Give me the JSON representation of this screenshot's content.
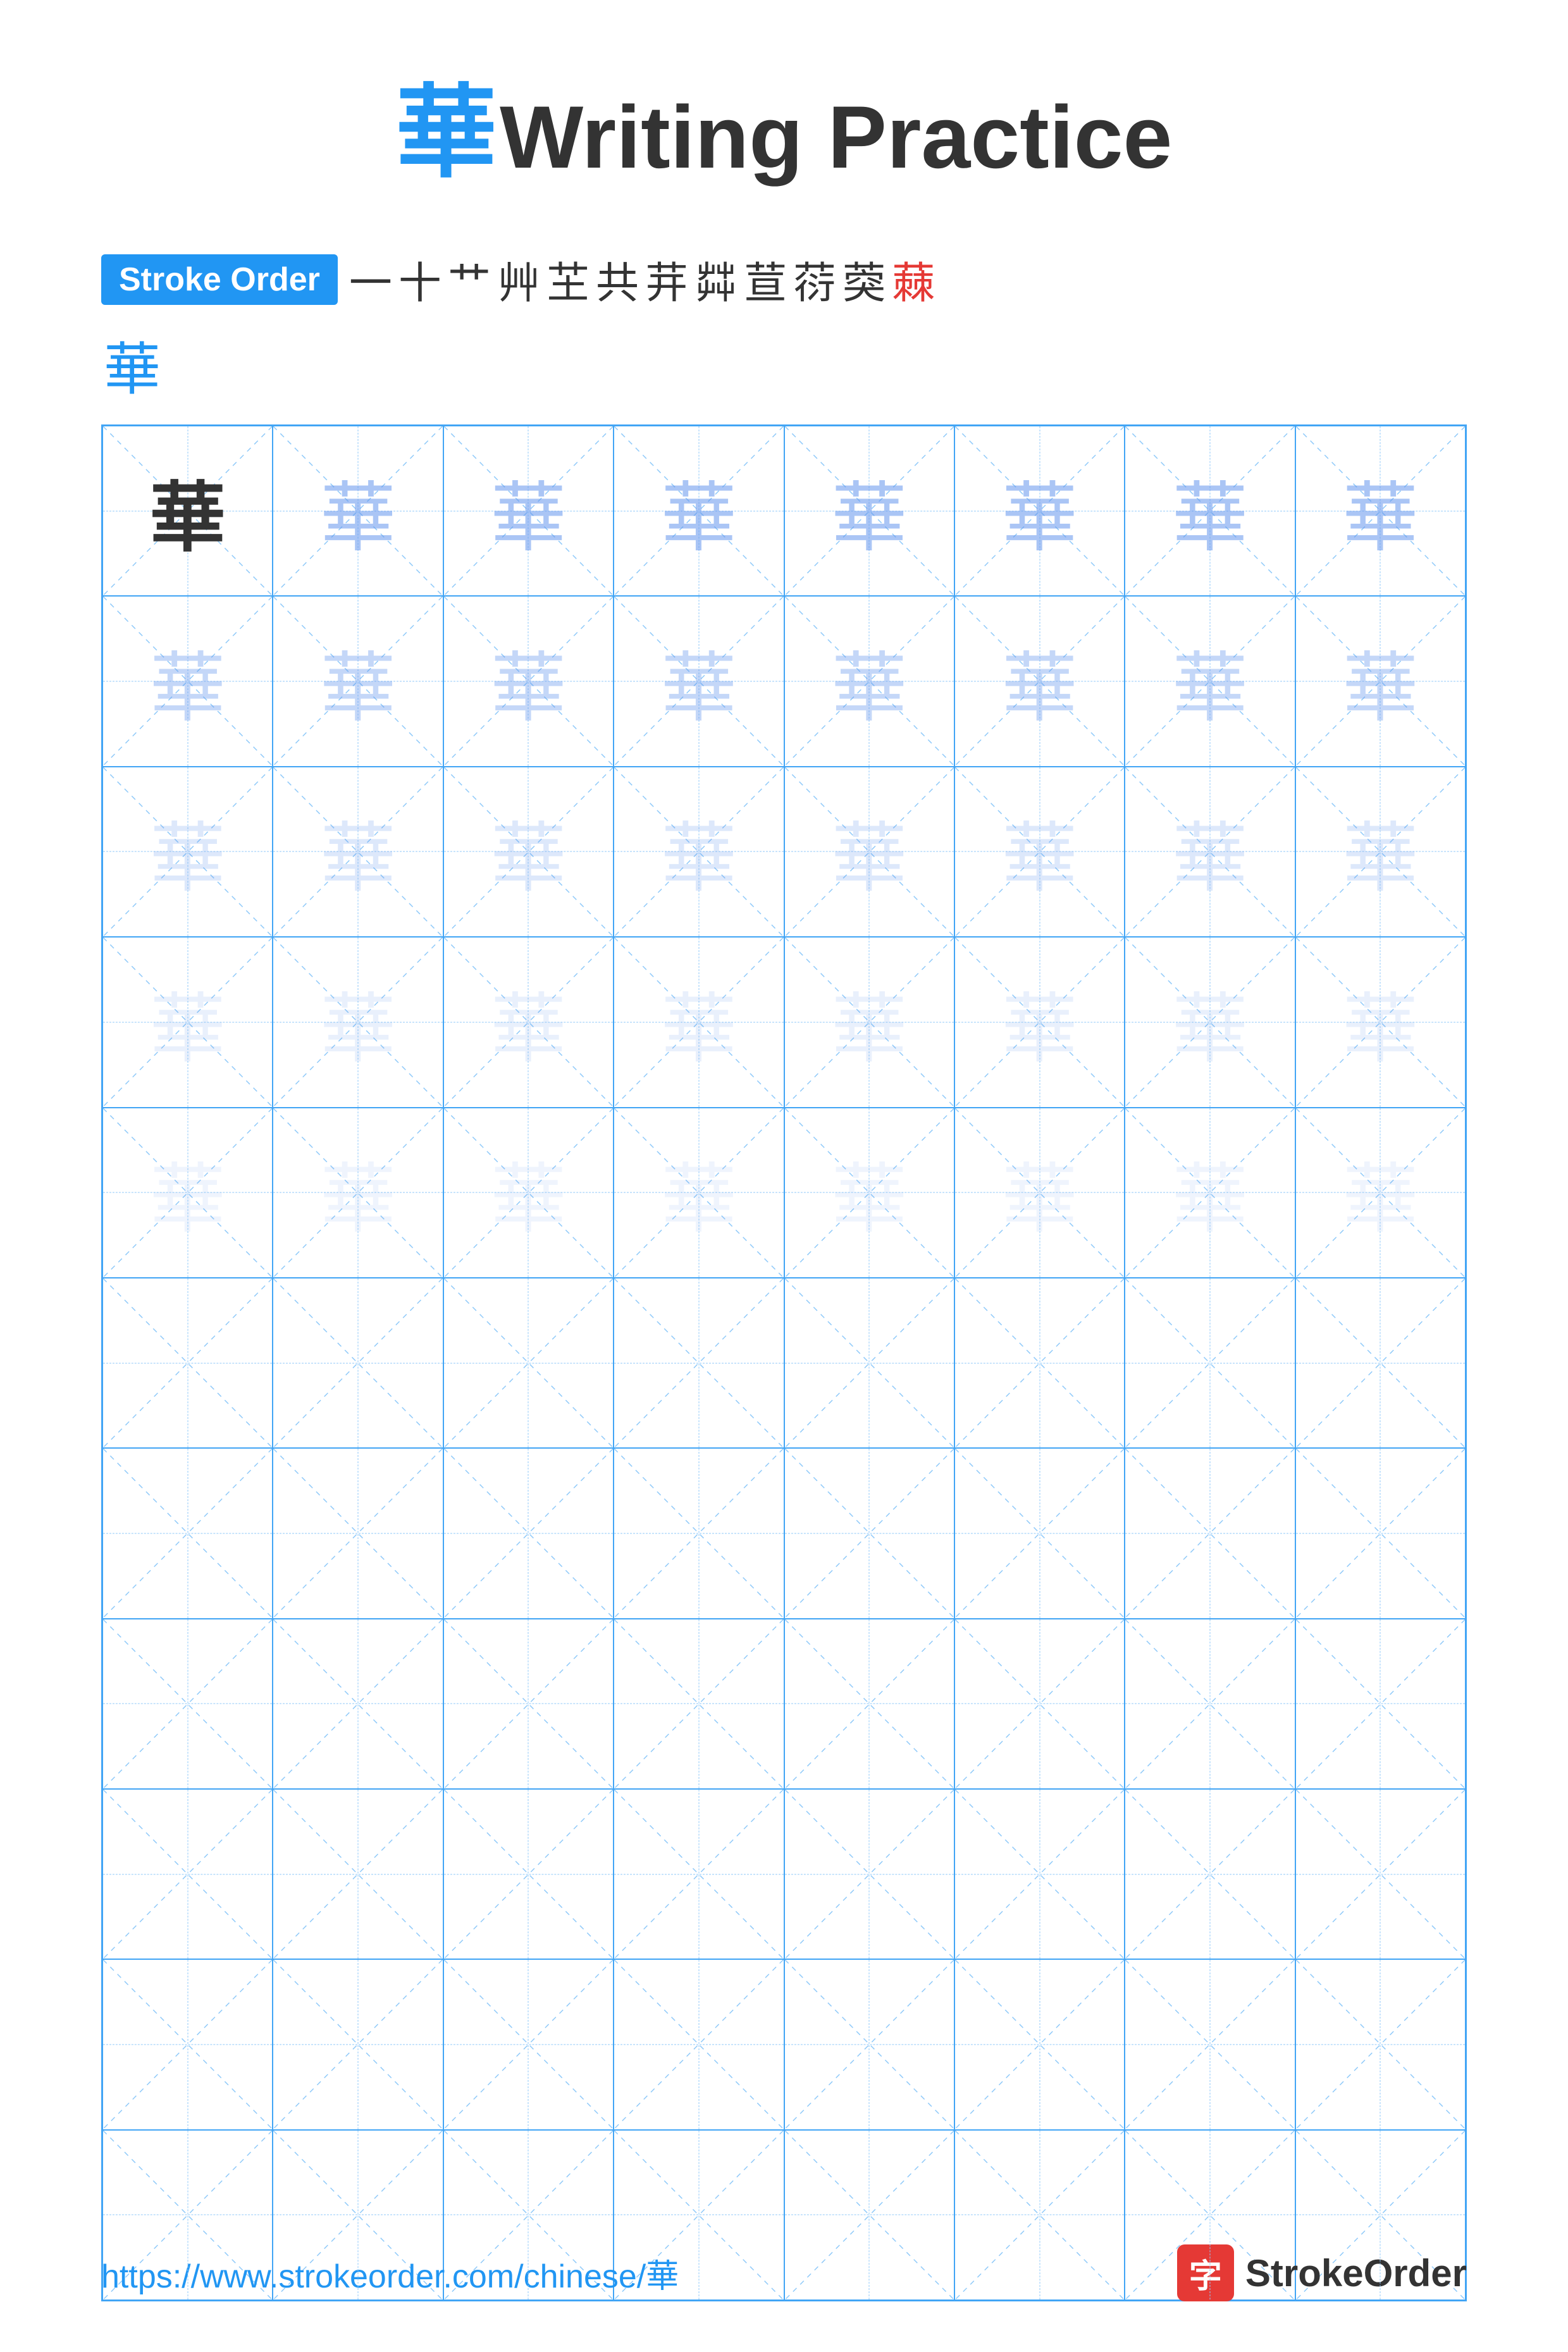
{
  "title": {
    "char": "華",
    "text": "Writing Practice"
  },
  "stroke_order": {
    "badge_label": "Stroke Order",
    "strokes": [
      "一",
      "十",
      "艹",
      "艸",
      "芓",
      "共",
      "茾",
      "茻",
      "荁",
      "葕",
      "葖",
      "蕀"
    ],
    "final_char": "華"
  },
  "grid": {
    "char": "華",
    "rows": 11,
    "cols": 8,
    "filled_rows": 5,
    "opacity_levels": [
      "dark",
      "gray1",
      "gray2",
      "gray3",
      "gray4"
    ]
  },
  "footer": {
    "url": "https://www.strokeorder.com/chinese/華",
    "brand_char": "字",
    "brand_name": "StrokeOrder"
  }
}
